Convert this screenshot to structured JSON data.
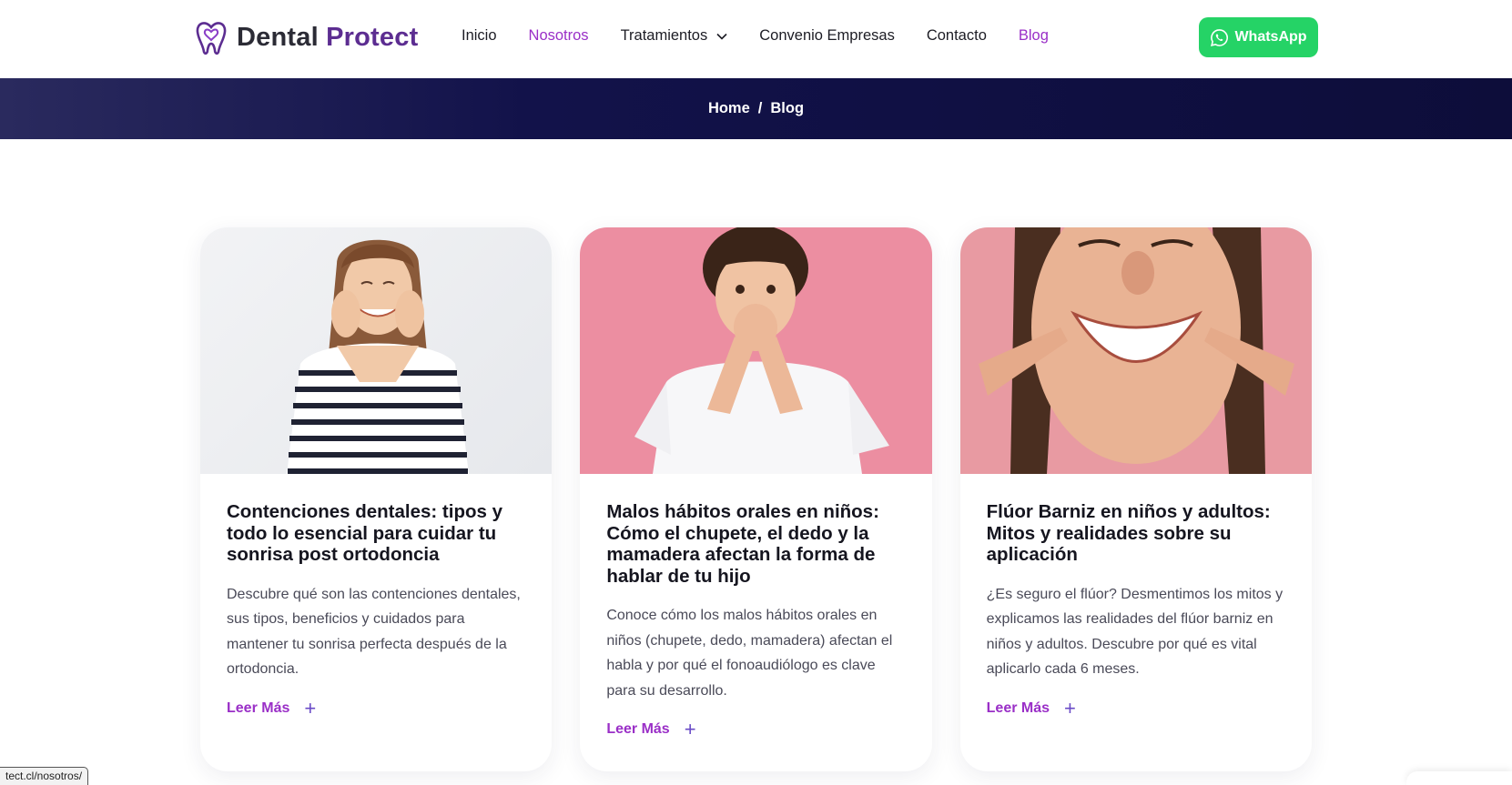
{
  "brand": {
    "name_part1": "Dental",
    "name_part2": "Protect",
    "accent_color": "#5c2d91",
    "logo_icon": "tooth-heart-icon"
  },
  "nav": {
    "items": [
      {
        "label": "Inicio",
        "active": false
      },
      {
        "label": "Nosotros",
        "active": true
      },
      {
        "label": "Tratamientos",
        "active": false,
        "dropdown": true
      },
      {
        "label": "Convenio Empresas",
        "active": false
      },
      {
        "label": "Contacto",
        "active": false
      },
      {
        "label": "Blog",
        "active": true
      }
    ],
    "whatsapp_label": "WhatsApp",
    "whatsapp_color": "#25d366"
  },
  "breadcrumb": {
    "home": "Home",
    "separator": "/",
    "current": "Blog"
  },
  "posts": [
    {
      "title": "Contenciones dentales: tipos y todo lo esencial para cuidar tu sonrisa post ortodoncia",
      "excerpt": "Descubre qué son las contenciones dentales, sus tipos, beneficios y cuidados para mantener tu sonrisa perfecta después de la ortodoncia.",
      "read_more": "Leer Más"
    },
    {
      "title": "Malos hábitos orales en niños: Cómo el chupete, el dedo y la mamadera afectan la forma de hablar de tu hijo",
      "excerpt": "Conoce cómo los malos hábitos orales en niños (chupete, dedo, mamadera) afectan el habla y por qué el fonoaudiólogo es clave para su desarrollo.",
      "read_more": "Leer Más"
    },
    {
      "title": "Flúor Barniz en niños y adultos: Mitos y realidades sobre su aplicación",
      "excerpt": "¿Es seguro el flúor? Desmentimos los mitos y explicamos las realidades del flúor barniz en niños y adultos. Descubre por qué es vital aplicarlo cada 6 meses.",
      "read_more": "Leer Más"
    }
  ],
  "status_bar": {
    "url": "tect.cl/nosotros/"
  },
  "colors": {
    "link_purple": "#9a2fc7",
    "banner_dark": "#0d0d3a"
  }
}
